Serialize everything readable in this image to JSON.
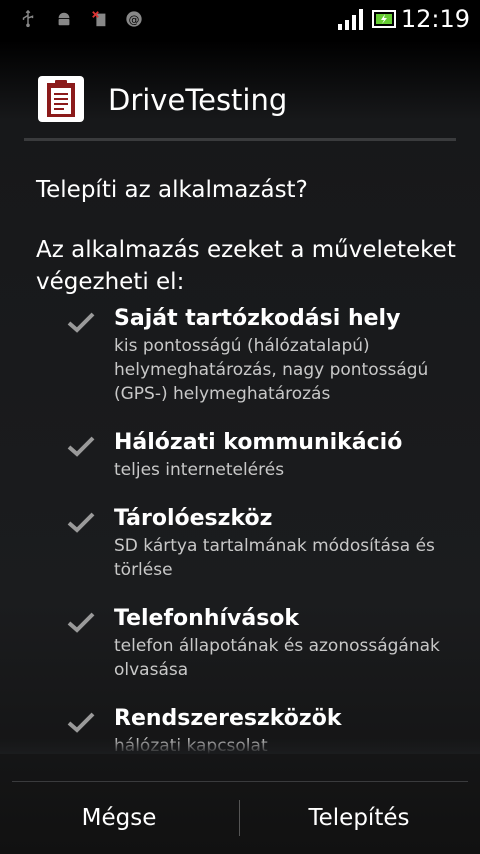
{
  "status_bar": {
    "time": "12:19",
    "left_icons": [
      "usb-icon",
      "android-debug-icon",
      "sim-error-icon",
      "at-icon"
    ],
    "right_icons": [
      "signal-icon",
      "battery-charging-icon"
    ]
  },
  "app": {
    "title": "DriveTesting",
    "icon": "clipboard-icon",
    "icon_color": "#8b1a1a"
  },
  "prompt": {
    "question": "Telepíti az alkalmazást?",
    "intro": "Az alkalmazás ezeket a műveleteket végezheti el:"
  },
  "permissions": [
    {
      "title": "Saját tartózkodási hely",
      "description": "kis pontosságú (hálózatalapú) helymeghatározás, nagy pontosságú (GPS-) helymeghatározás"
    },
    {
      "title": "Hálózati kommunikáció",
      "description": "teljes internetelérés"
    },
    {
      "title": "Tárolóeszköz",
      "description": "SD kártya tartalmának módosítása és törlése"
    },
    {
      "title": "Telefonhívások",
      "description": "telefon állapotának és azonosságának olvasása"
    },
    {
      "title": "Rendszereszközök",
      "description": "hálózati kapcsolat"
    }
  ],
  "buttons": {
    "cancel": "Mégse",
    "install": "Telepítés"
  }
}
